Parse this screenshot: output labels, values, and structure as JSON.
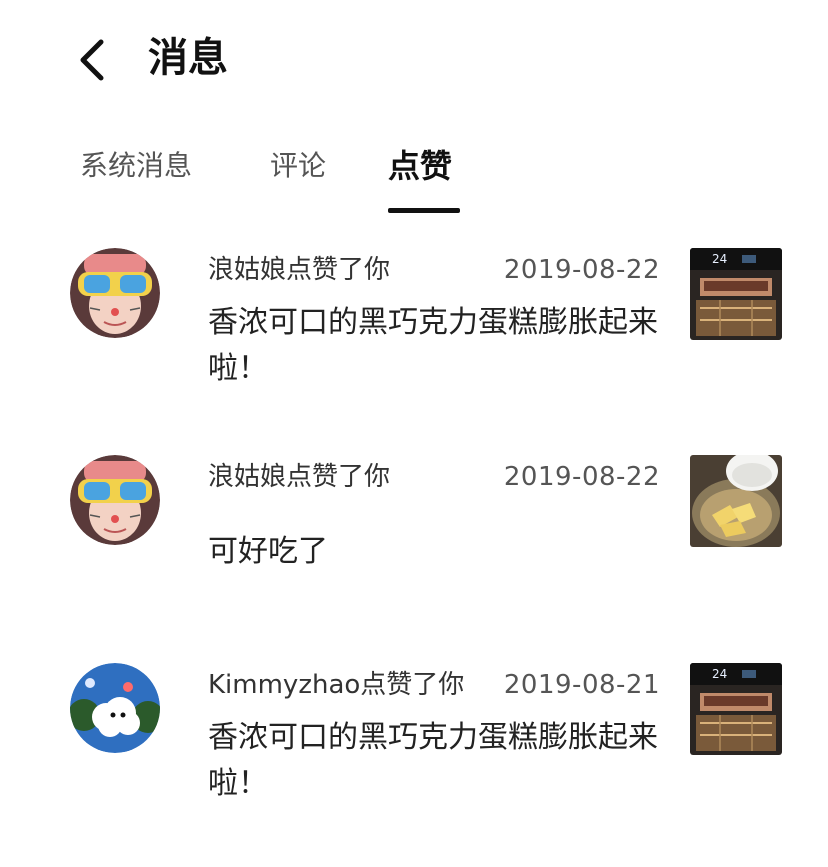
{
  "header": {
    "title": "消息",
    "back_icon": "chevron-left-icon"
  },
  "tabs": [
    {
      "label": "系统消息",
      "active": false
    },
    {
      "label": "评论",
      "active": false
    },
    {
      "label": "点赞",
      "active": true
    }
  ],
  "messages": [
    {
      "user_action": "浪姑娘点赞了你",
      "date": "2019-08-22",
      "content": "香浓可口的黑巧克力蛋糕膨胀起来啦！",
      "avatar": "girl-with-goggles-avatar",
      "thumbnail": "oven-cake-photo"
    },
    {
      "user_action": "浪姑娘点赞了你",
      "date": "2019-08-22",
      "content": "可好吃了",
      "avatar": "girl-with-goggles-avatar",
      "thumbnail": "butter-bowl-photo"
    },
    {
      "user_action": "Kimmyzhao点赞了你",
      "date": "2019-08-21",
      "content": "香浓可口的黑巧克力蛋糕膨胀起来啦！",
      "avatar": "cloud-cartoon-avatar",
      "thumbnail": "oven-cake-photo"
    }
  ]
}
